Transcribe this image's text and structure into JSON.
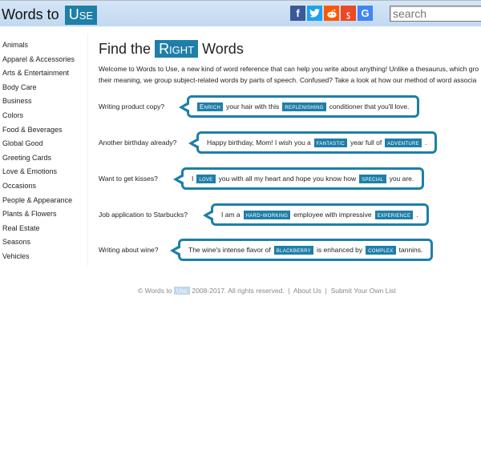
{
  "header": {
    "logo_prefix": "Words to",
    "logo_highlight": "Use",
    "social": [
      {
        "name": "facebook",
        "glyph": "f"
      },
      {
        "name": "twitter",
        "glyph": "t"
      },
      {
        "name": "reddit",
        "glyph": "r"
      },
      {
        "name": "stumbleupon",
        "glyph": "su"
      },
      {
        "name": "google",
        "glyph": "G"
      }
    ],
    "search_placeholder": "search"
  },
  "sidebar": {
    "items": [
      "Animals",
      "Apparel & Accessories",
      "Arts & Entertainment",
      "Body Care",
      "Business",
      "Colors",
      "Food & Beverages",
      "Global Good",
      "Greeting Cards",
      "Love & Emotions",
      "Occasions",
      "People & Appearance",
      "Plants & Flowers",
      "Real Estate",
      "Seasons",
      "Vehicles"
    ]
  },
  "main": {
    "title_prefix": "Find the",
    "title_highlight": "Right",
    "title_suffix": "Words",
    "intro_line1": "Welcome to Words to Use, a new kind of word reference that can help you write about anything! Unlike a thesaurus, which gro",
    "intro_line2": "their meaning, we group subject-related words by parts of speech. Confused? Take a look at how our method of word associa",
    "examples": [
      {
        "question": "Writing product copy?",
        "parts": [
          {
            "hl": "Enrich"
          },
          {
            "t": "your hair with this"
          },
          {
            "hl": "replenishing"
          },
          {
            "t": "conditioner that you'll love."
          }
        ]
      },
      {
        "question": "Another birthday already?",
        "parts": [
          {
            "t": "Happy birthday, Mom! I wish you a"
          },
          {
            "hl": "fantastic"
          },
          {
            "t": "year full of"
          },
          {
            "hl": "adventure"
          },
          {
            "t": "."
          }
        ]
      },
      {
        "question": "Want to get kisses?",
        "parts": [
          {
            "t": "I"
          },
          {
            "hl": "love"
          },
          {
            "t": "you with all my heart and hope you know how"
          },
          {
            "hl": "special"
          },
          {
            "t": "you are."
          }
        ]
      },
      {
        "question": "Job application to Starbucks?",
        "parts": [
          {
            "t": "I am a"
          },
          {
            "hl": "hard-working"
          },
          {
            "t": "employee with impressive"
          },
          {
            "hl": "experience"
          },
          {
            "t": "."
          }
        ]
      },
      {
        "question": "Writing about wine?",
        "parts": [
          {
            "t": "The wine's intense flavor of"
          },
          {
            "hl": "blackberry"
          },
          {
            "t": "is enhanced by"
          },
          {
            "hl": "complex"
          },
          {
            "t": "tannins."
          }
        ]
      }
    ]
  },
  "footer": {
    "copyright_prefix": "© Words to",
    "copyright_highlight": "Use",
    "copyright_suffix": "2008-2017. All rights reserved.",
    "separator": "|",
    "about_link": "About Us",
    "submit_link": "Submit Your Own List"
  },
  "colors": {
    "accent": "#1e7fa8",
    "header_bg": "#c8ddf2"
  }
}
